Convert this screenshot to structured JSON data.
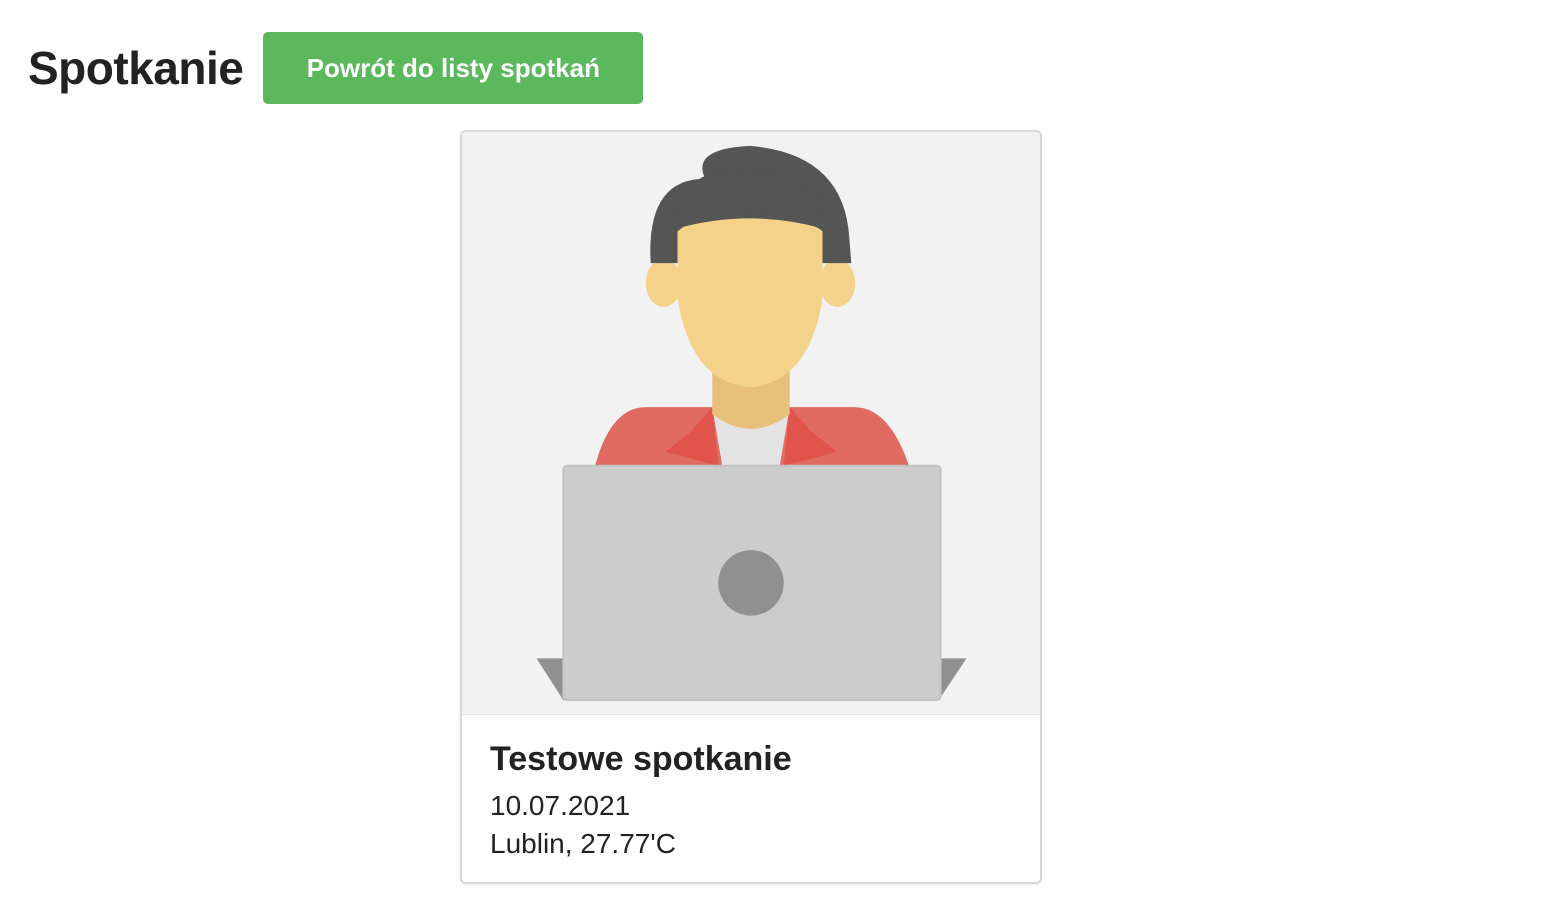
{
  "header": {
    "title": "Spotkanie",
    "back_button_label": "Powrót do listy spotkań"
  },
  "meeting": {
    "title": "Testowe spotkanie",
    "date": "10.07.2021",
    "location_weather": "Lublin, 27.77'C"
  },
  "colors": {
    "button_bg": "#5cb85c",
    "illustration_bg": "#f2f2f2",
    "hair": "#555555",
    "skin": "#f5d289",
    "jacket": "#e06b63",
    "laptop": "#cccccc"
  },
  "icons": {
    "illustration": "person-at-laptop-icon"
  }
}
